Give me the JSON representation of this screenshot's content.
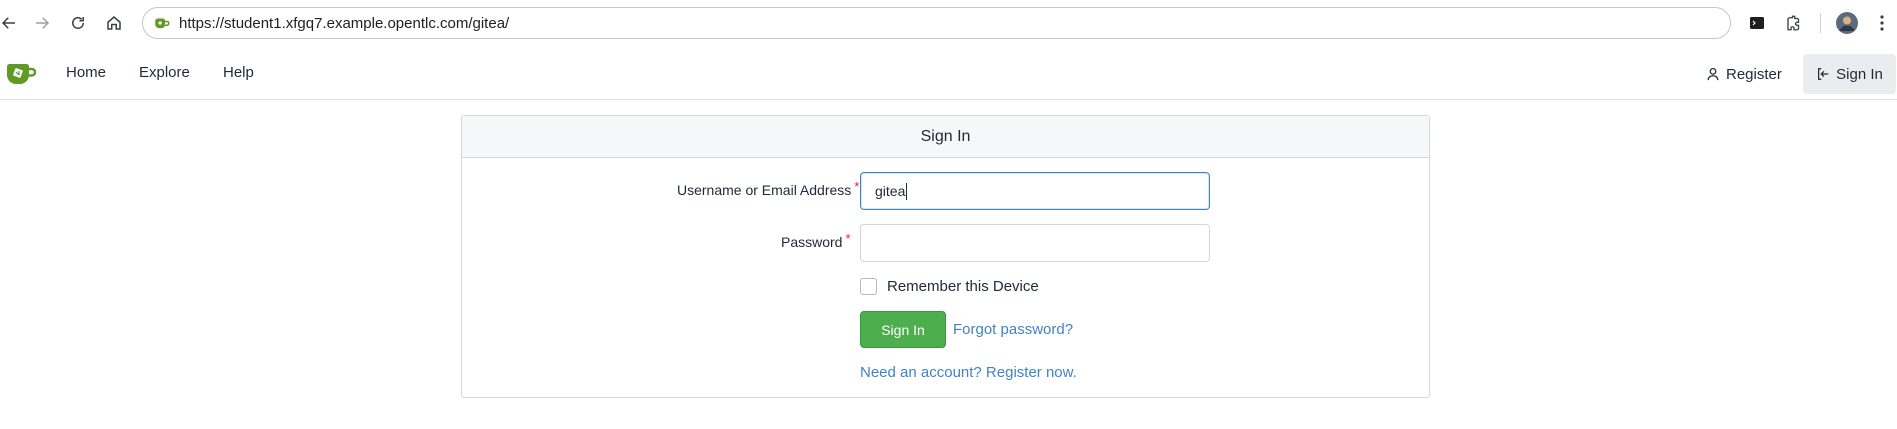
{
  "browser": {
    "url": "https://student1.xfgq7.example.opentlc.com/gitea/",
    "icons": [
      "back-icon",
      "forward-icon",
      "reload-icon",
      "home-icon",
      "site-info-icon",
      "terminal-icon",
      "extensions-icon",
      "profile-avatar",
      "more-menu-icon"
    ]
  },
  "header": {
    "nav": [
      "Home",
      "Explore",
      "Help"
    ],
    "register_label": "Register",
    "signin_label": "Sign In"
  },
  "form": {
    "title": "Sign In",
    "username_label": "Username or Email Address",
    "username_value": "gitea",
    "password_label": "Password",
    "required_mark": "*",
    "remember_label": "Remember this Device",
    "submit_label": "Sign In",
    "forgot_label": "Forgot password?",
    "register_prompt": "Need an account? Register now."
  },
  "colors": {
    "accent_green": "#4cae4c",
    "link_blue": "#4183c4",
    "required_red": "#db2828",
    "logo_green": "#609926"
  }
}
